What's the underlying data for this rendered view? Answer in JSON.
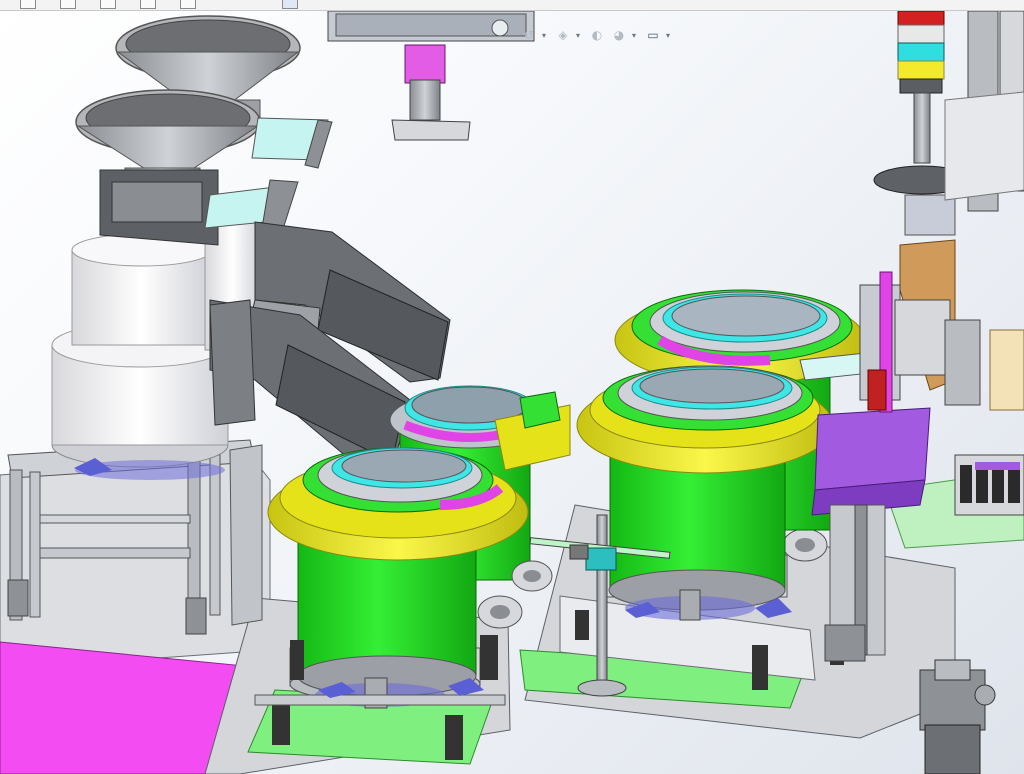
{
  "app": {
    "name": "3D CAD assembly viewport"
  },
  "colors": {
    "background_top": "#ffffff",
    "background_bottom": "#dfe4ec",
    "bowl_green": "#1fd81f",
    "rim_yellow": "#e6e21a",
    "track_magenta": "#e043e6",
    "track_cyan": "#3fe6e6",
    "plate_green": "#7ff07f",
    "steel_grey": "#c8ccd2",
    "dark_grey": "#5f6266",
    "plate_magenta": "#f24cf2",
    "stand_purple": "#a25be0"
  },
  "toolbar": {
    "icons": [
      "display-style-icon",
      "hide-show-icon",
      "edit-appearance-icon",
      "apply-scene-icon",
      "view-settings-icon"
    ]
  },
  "heads_up_toolbar": {
    "icons": [
      "view-orientation-icon",
      "section-view-icon",
      "display-style-icon",
      "hide-show-items-icon",
      "edit-appearance-icon",
      "apply-scene-icon",
      "view-settings-icon",
      "monitor-icon"
    ]
  },
  "scene": {
    "components": [
      "hopper-funnel",
      "hopper-funnel",
      "vibratory-bowl-feeder",
      "vibratory-bowl-feeder",
      "vibratory-bowl-feeder",
      "vibratory-bowl-feeder",
      "linear-feeder-track",
      "control-panel",
      "signal-tower-light",
      "pneumatic-cylinder",
      "air-filter-regulator"
    ]
  }
}
